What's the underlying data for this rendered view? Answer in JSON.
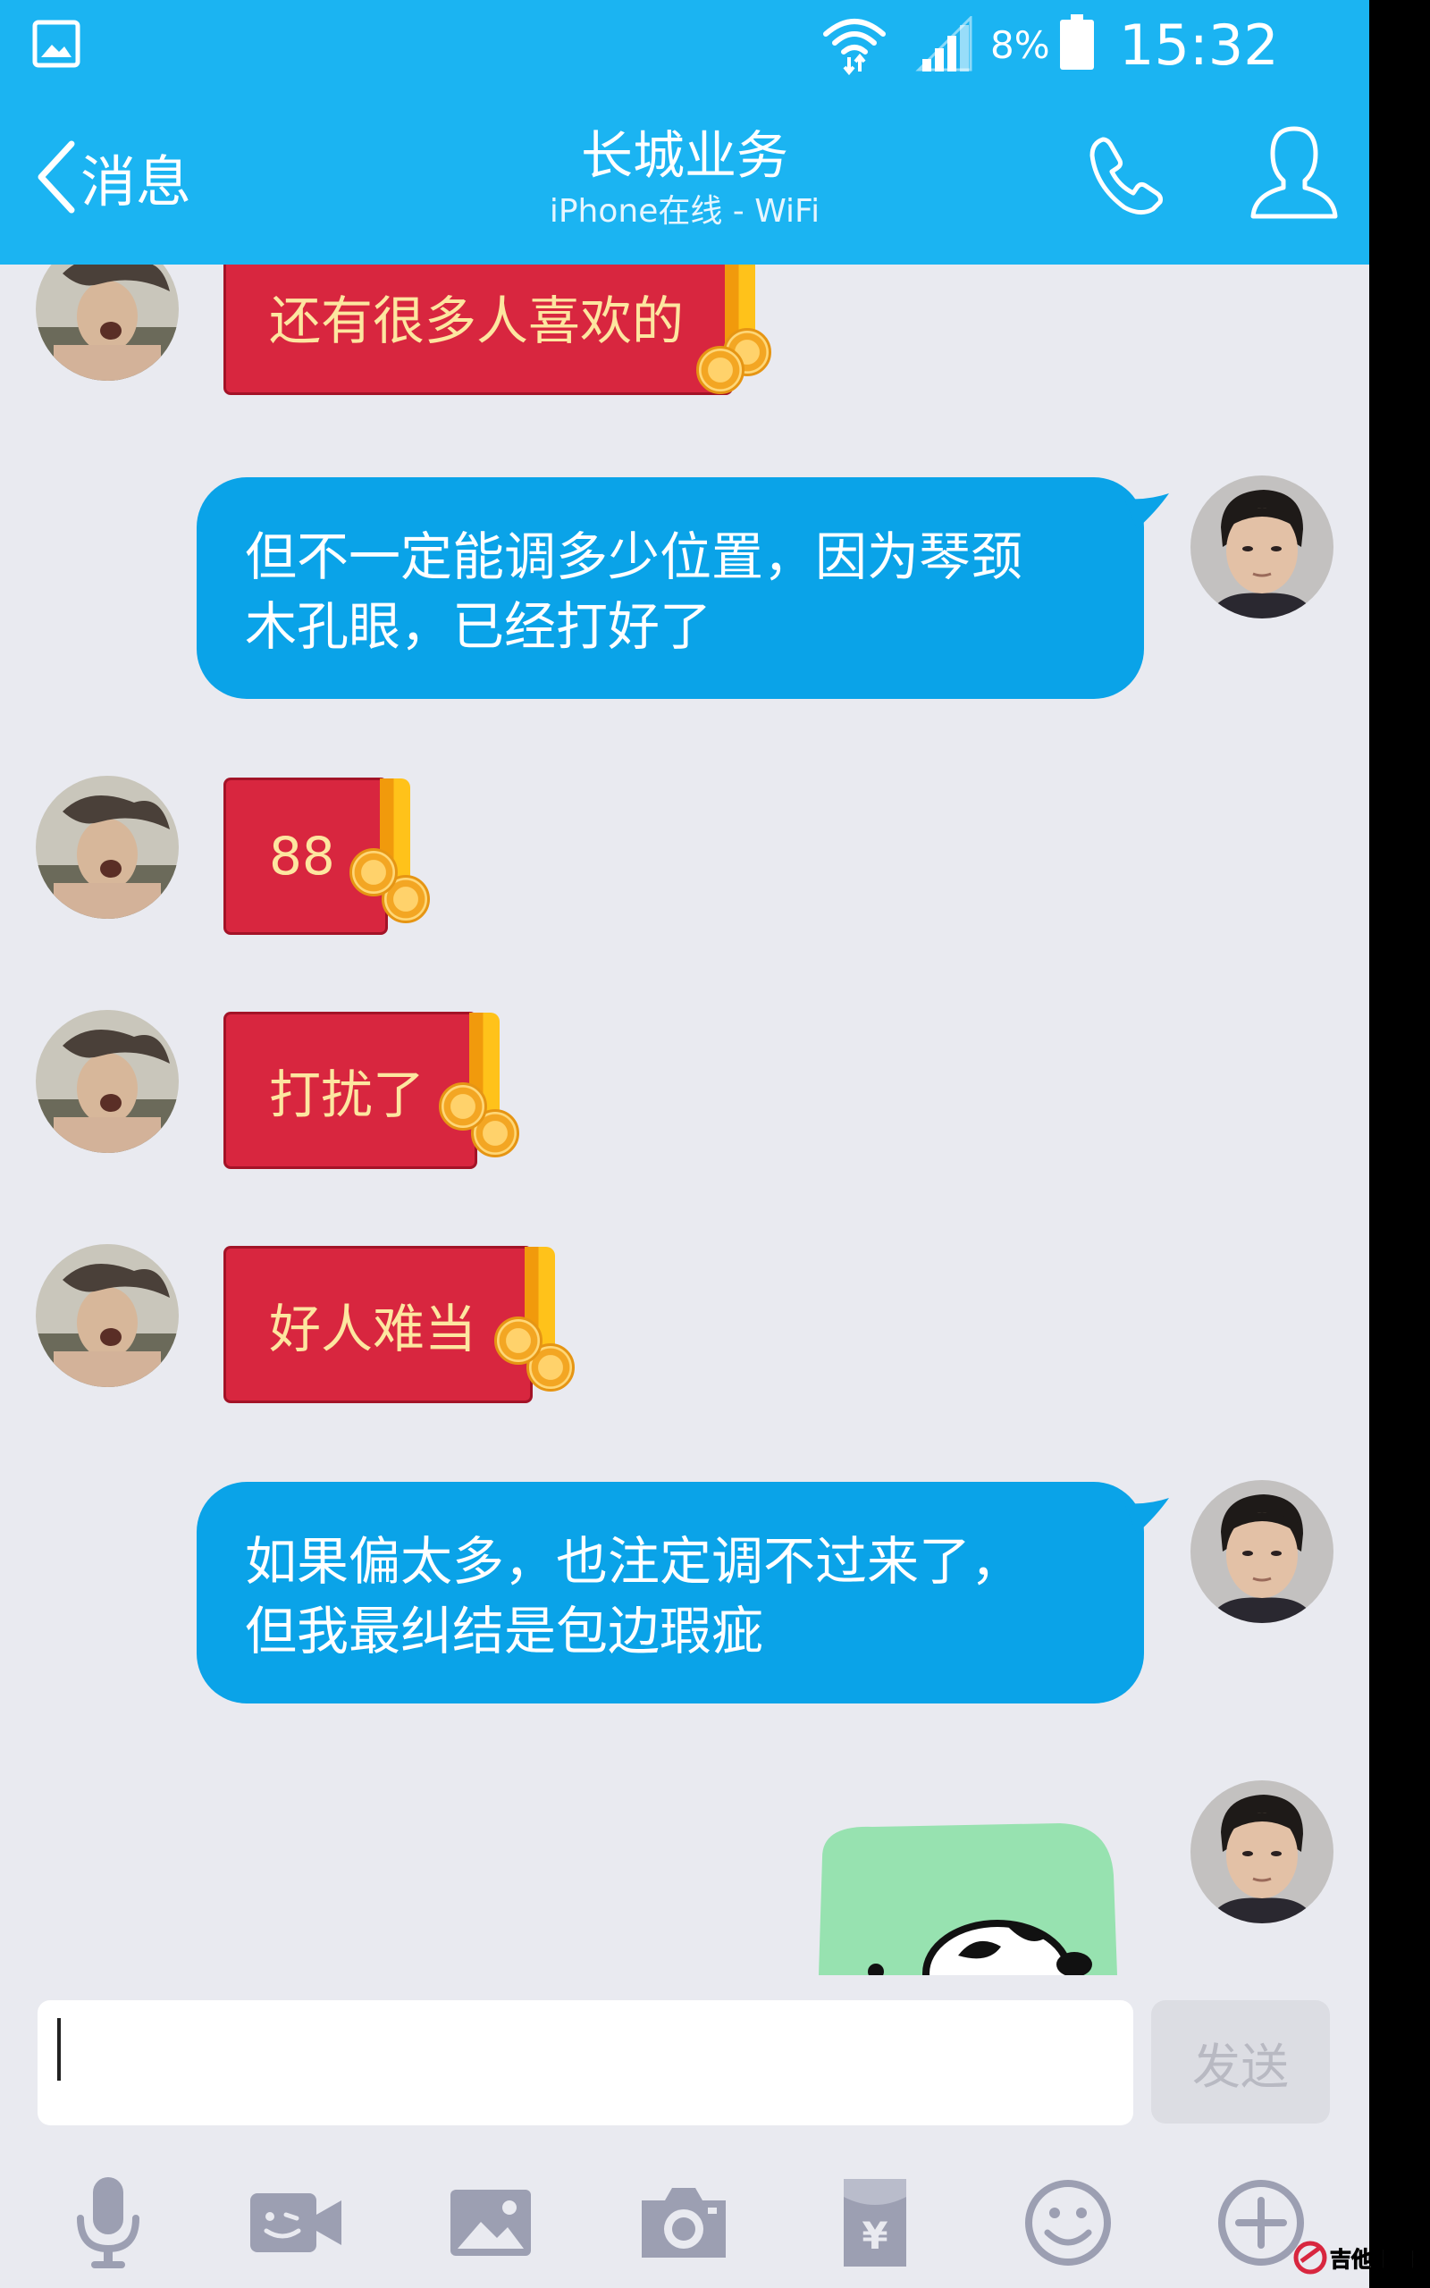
{
  "status_bar": {
    "battery_percent": "8%",
    "time": "15:32"
  },
  "header": {
    "back_label": "消息",
    "title": "长城业务",
    "subtitle": "iPhone在线 - WiFi"
  },
  "messages": [
    {
      "side": "left",
      "kind": "red-packet",
      "text": "还有很多人喜欢的"
    },
    {
      "side": "right",
      "kind": "text",
      "lines": [
        "但不一定能调多少位置，因为琴颈",
        "木孔眼，已经打好了"
      ]
    },
    {
      "side": "left",
      "kind": "red-packet",
      "text": "88"
    },
    {
      "side": "left",
      "kind": "red-packet",
      "text": "打扰了"
    },
    {
      "side": "left",
      "kind": "red-packet",
      "text": "好人难当"
    },
    {
      "side": "right",
      "kind": "text",
      "lines": [
        "如果偏太多，也注定调不过来了，",
        "但我最纠结是包边瑕疵"
      ]
    },
    {
      "side": "right",
      "kind": "sticker"
    }
  ],
  "composer": {
    "input_value": "",
    "send_label": "发送"
  },
  "toolbar": {
    "items": [
      "microphone-icon",
      "video-call-icon",
      "image-icon",
      "camera-icon",
      "red-packet-icon",
      "emoji-icon",
      "plus-icon"
    ]
  },
  "watermark": {
    "text": "吉他中国"
  },
  "colors": {
    "header_bg": "#1bb4f2",
    "bubble_out": "#0aa3e8",
    "red_packet": "#d8263f",
    "red_packet_text": "#fde6a0",
    "chat_bg": "#e9eaf0",
    "icon_gray": "#9c9fb2"
  }
}
